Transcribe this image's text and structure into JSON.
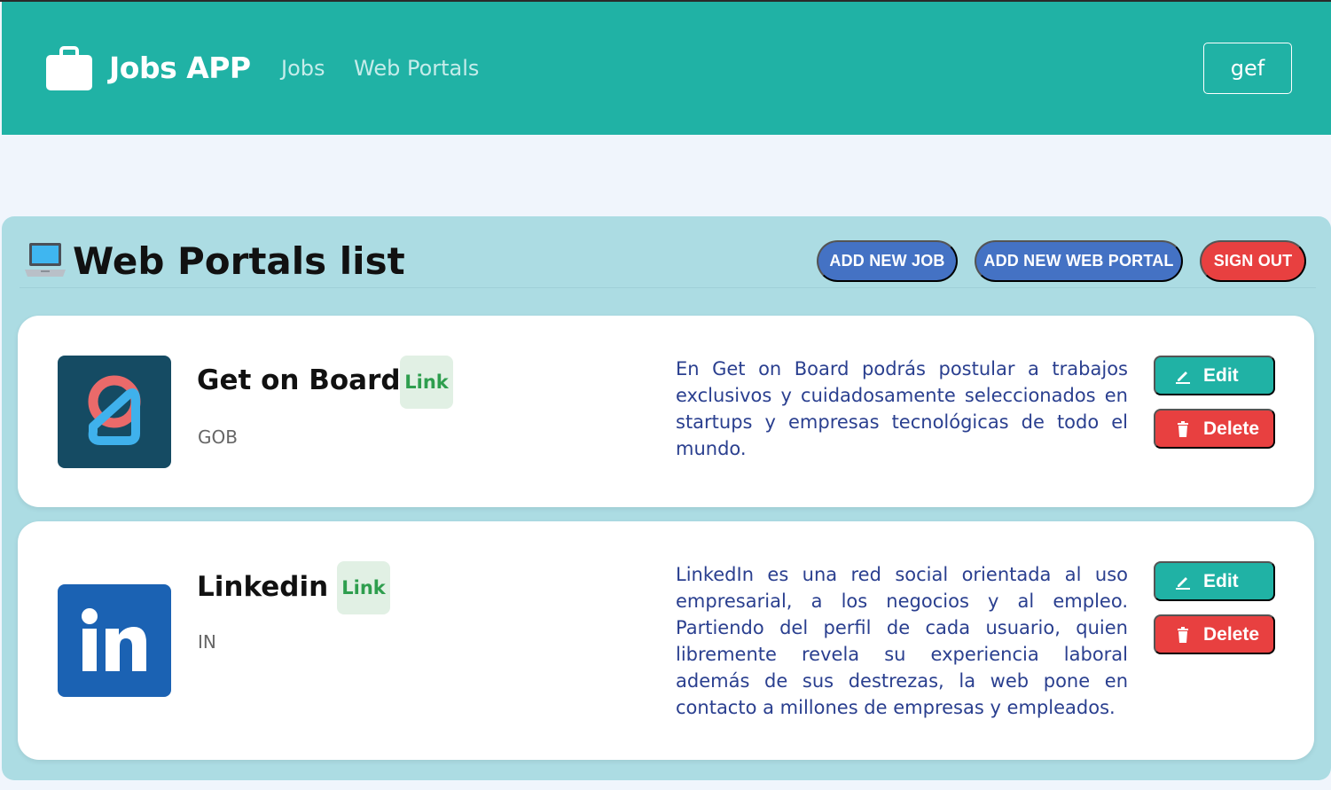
{
  "navbar": {
    "brand": "Jobs APP",
    "brand_icon": "briefcase-icon",
    "links": [
      "Jobs",
      "Web Portals"
    ],
    "user": "gef",
    "background": "#20b2a5"
  },
  "panel": {
    "title_icon": "laptop-icon",
    "title": "Web Portals list",
    "buttons": {
      "add_job": "ADD NEW JOB",
      "add_portal": "ADD NEW WEB PORTAL",
      "sign_out": "SIGN OUT"
    },
    "background": "#acdce3"
  },
  "portals": [
    {
      "name": "Get on Board",
      "code": "GOB",
      "link_label": "Link",
      "description": "En Get on Board podrás postular a trabajos exclusivos y cuidadosamente seleccionados en startups y empresas tecnológicas de todo el mundo.",
      "edit_label": "Edit",
      "delete_label": "Delete",
      "logo": "getonboard-logo"
    },
    {
      "name": "Linkedin",
      "code": "IN",
      "link_label": "Link",
      "description": "LinkedIn es una red social orientada al uso empresarial, a los negocios y al empleo. Partiendo del perfil de cada usuario, quien libremente revela su experiencia laboral además de sus destrezas, la web pone en contacto a millones de empresas y empleados.",
      "edit_label": "Edit",
      "delete_label": "Delete",
      "logo": "linkedin-logo"
    }
  ],
  "colors": {
    "primary": "#20b2a5",
    "blue_button": "#4472c4",
    "danger": "#e84040",
    "description_text": "#2a3f8f",
    "link_badge_text": "#2e9e4e"
  }
}
